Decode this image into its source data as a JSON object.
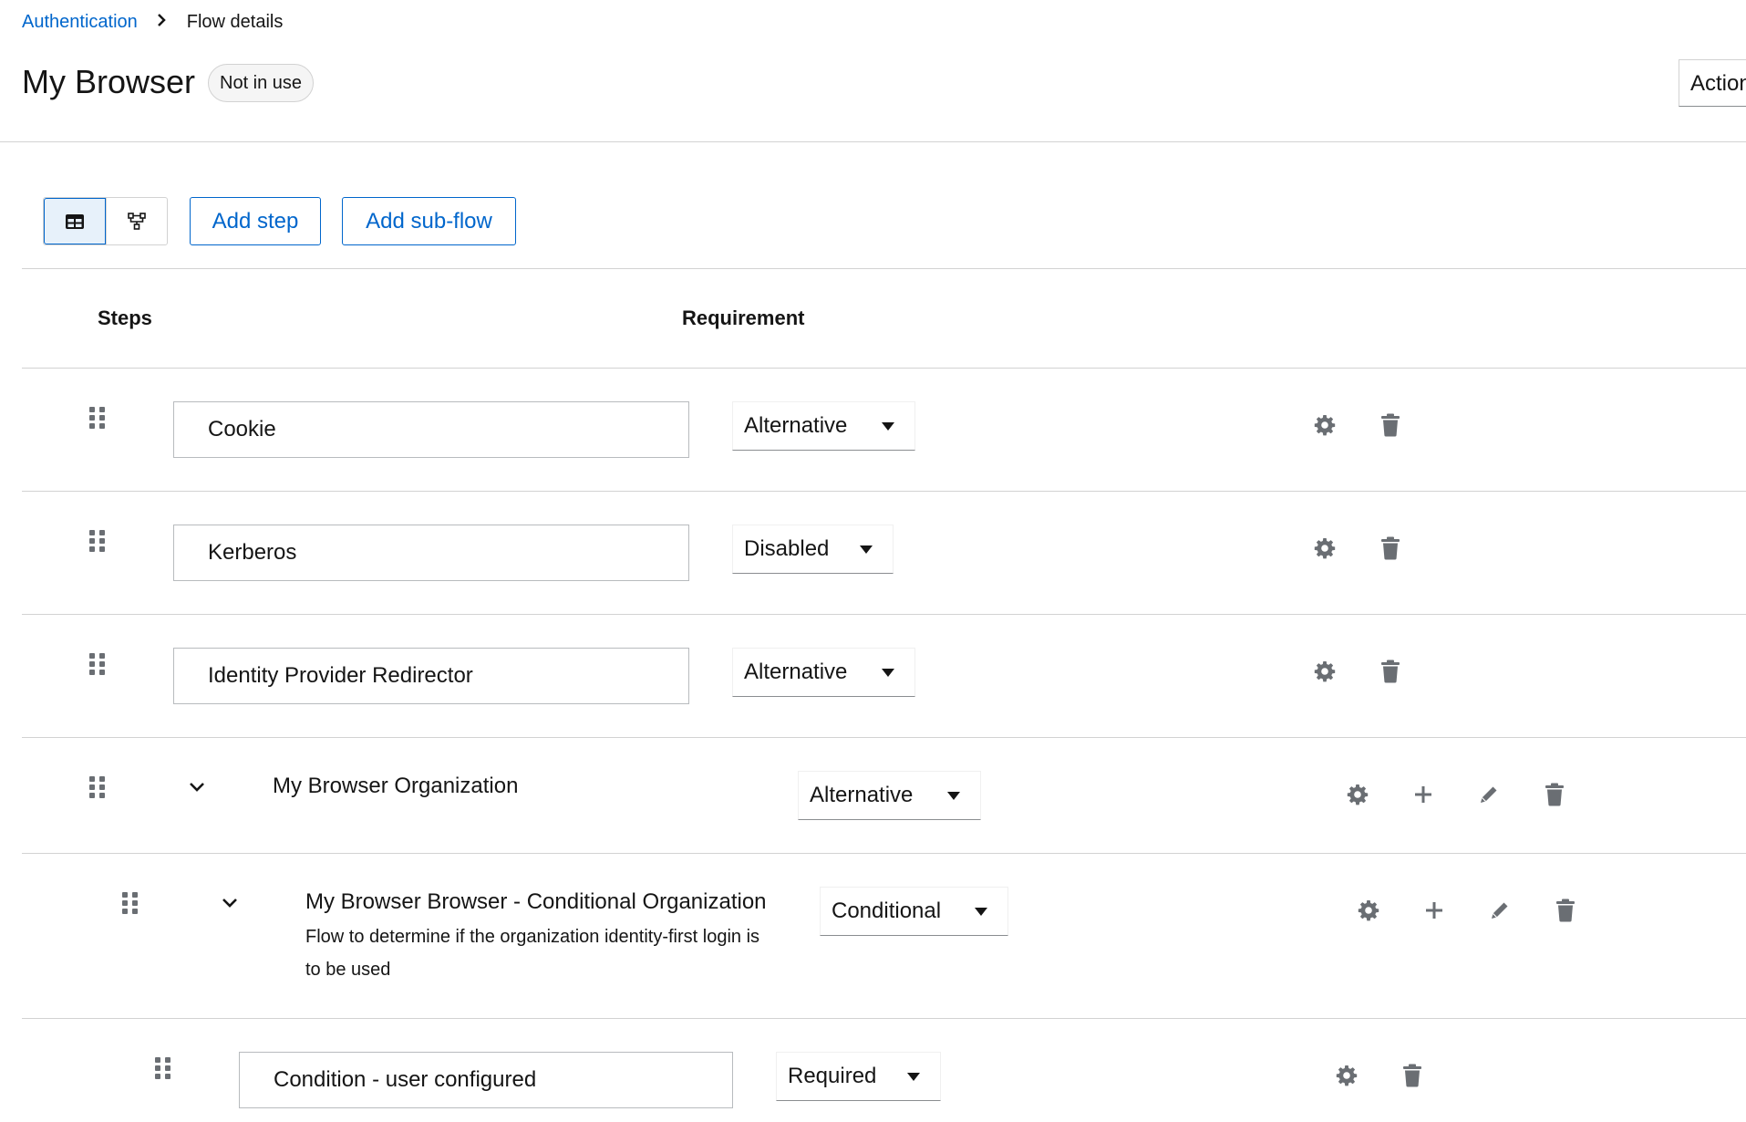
{
  "breadcrumb": {
    "parent": "Authentication",
    "current": "Flow details"
  },
  "header": {
    "title": "My Browser",
    "badge": "Not in use",
    "action": "Action"
  },
  "toolbar": {
    "view_table_icon": "table-icon",
    "view_diagram_icon": "diagram-icon",
    "add_step": "Add step",
    "add_subflow": "Add sub-flow"
  },
  "table": {
    "col_steps": "Steps",
    "col_requirement": "Requirement"
  },
  "rows": [
    {
      "name": "Cookie",
      "requirement": "Alternative"
    },
    {
      "name": "Kerberos",
      "requirement": "Disabled"
    },
    {
      "name": "Identity Provider Redirector",
      "requirement": "Alternative"
    },
    {
      "name": "My Browser Organization",
      "requirement": "Alternative"
    },
    {
      "name": "My Browser Browser - Conditional Organization",
      "description": "Flow to determine if the organization identity-first login is to be used",
      "requirement": "Conditional"
    },
    {
      "name": "Condition - user configured",
      "requirement": "Required"
    }
  ],
  "colors": {
    "link": "#0066cc",
    "icon": "#6a6e73",
    "border": "#d2d2d2"
  }
}
